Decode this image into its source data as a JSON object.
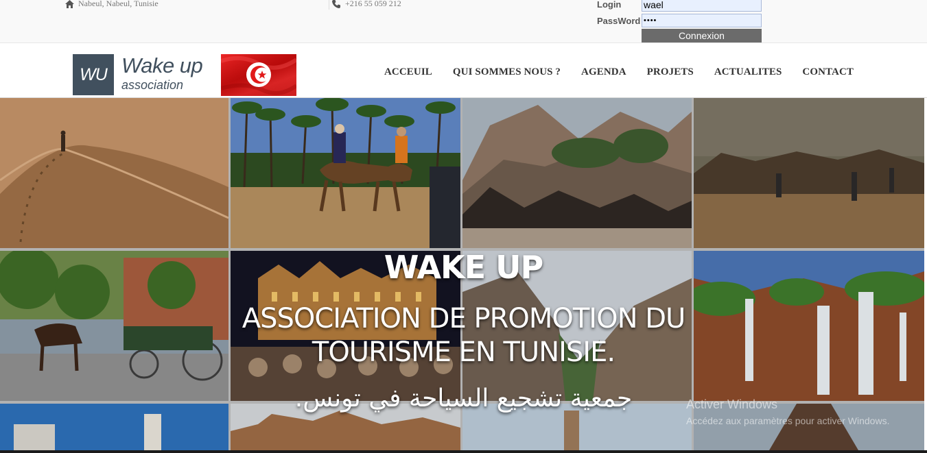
{
  "topbar": {
    "address": "Nabeul, Nabeul, Tunisie",
    "phone": "+216 55 059 212",
    "login_label": "Login",
    "password_label": "PassWord",
    "login_value": "wael",
    "password_value": "••••",
    "connect_label": "Connexion",
    "home_icon": "home-icon",
    "phone_icon": "phone-icon"
  },
  "logo": {
    "initials": "WU",
    "name": "Wake up",
    "subtitle": "association"
  },
  "nav": {
    "items": [
      {
        "label": "ACCEUIL"
      },
      {
        "label": "QUI SOMMES NOUS ?"
      },
      {
        "label": "AGENDA"
      },
      {
        "label": "PROJETS"
      },
      {
        "label": "ACTUALITES"
      },
      {
        "label": "CONTACT"
      }
    ]
  },
  "hero": {
    "title": "WAKE UP",
    "subtitle": "ASSOCIATION DE PROMOTION DU TOURISME EN TUNISIE.",
    "arabic": "جمعية تشجيع السياحة في تونس."
  },
  "watermark": {
    "line1": "Activer Windows",
    "line2": "Accédez aux paramètres pour activer Windows."
  },
  "colors": {
    "brand": "#41505e",
    "flag_red": "#e11a1a",
    "button_gray": "#6b6b6b"
  }
}
